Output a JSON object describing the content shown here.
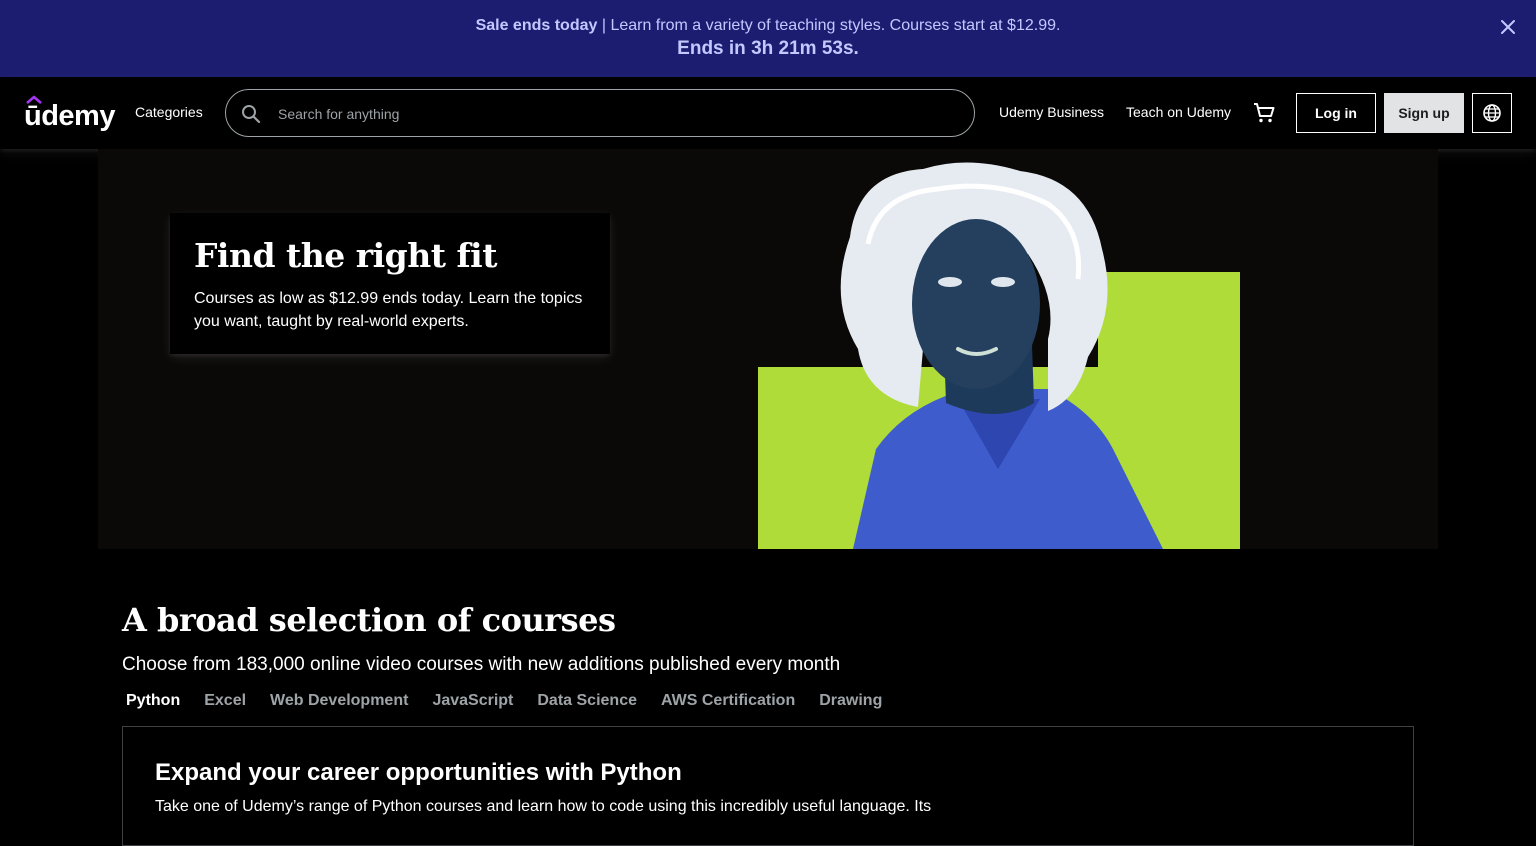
{
  "banner": {
    "sale_label": "Sale ends today",
    "message": " | Learn from a variety of teaching styles. Courses start at $12.99.",
    "countdown": "Ends in 3h 21m 53s."
  },
  "header": {
    "logo": "ūdemy",
    "categories": "Categories",
    "search_placeholder": "Search for anything",
    "business": "Udemy Business",
    "teach": "Teach on Udemy",
    "login": "Log in",
    "signup": "Sign up"
  },
  "hero": {
    "title": "Find the right fit",
    "text": "Courses as low as $12.99 ends today. Learn the topics you want, taught by real-world experts."
  },
  "courses": {
    "title": "A broad selection of courses",
    "subtitle": "Choose from 183,000 online video courses with new additions published every month",
    "tabs": [
      "Python",
      "Excel",
      "Web Development",
      "JavaScript",
      "Data Science",
      "AWS Certification",
      "Drawing"
    ],
    "active_tab": "Python",
    "panel_title": "Expand your career opportunities with Python",
    "panel_text": "Take one of Udemy’s range of Python courses and learn how to code using this incredibly useful language. Its"
  },
  "colors": {
    "banner_bg": "#1c1d71",
    "hero_accent": "#b0dc3a",
    "portrait_blue": "#3f5ccc"
  }
}
